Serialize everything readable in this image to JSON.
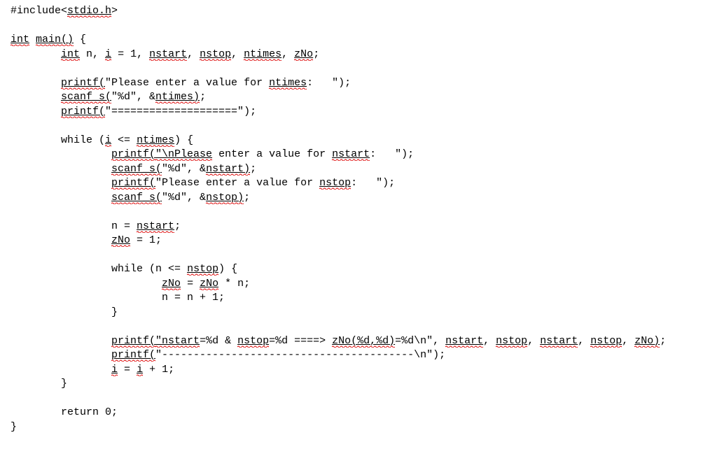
{
  "code": {
    "include": "#include<",
    "include_hdr": "stdio.h",
    "include_close": ">",
    "int_kw": "int",
    "main_decl": "main()",
    "main_open": " {",
    "decl_int": "int",
    "decl_n": " n, ",
    "decl_i": "i",
    "decl_eq1": " = 1, ",
    "decl_nstart": "nstart",
    "decl_c1": ", ",
    "decl_nstop": "nstop",
    "decl_c2": ", ",
    "decl_ntimes": "ntimes",
    "decl_c3": ", ",
    "decl_zno": "zNo",
    "decl_semi": ";",
    "p1_fn": "printf(",
    "p1_str": "\"Please enter a value for ",
    "p1_id": "ntimes",
    "p1_str2": ":   \");",
    "s1_fn": "scanf_s(",
    "s1_fmt": "\"%d\", &",
    "s1_id": "ntimes)",
    "s1_semi": ";",
    "p2_fn": "printf(",
    "p2_str": "\"====================\");",
    "w1_head1": "while (",
    "w1_i": "i",
    "w1_head2": " <= ",
    "w1_nt": "ntimes",
    "w1_head3": ") {",
    "p3_fn": "printf(",
    "p3_esc": "\"\\nPlease",
    "p3_mid": " enter a value for ",
    "p3_id": "nstart",
    "p3_end": ":   \");",
    "s2_fn": "scanf_s(",
    "s2_fmt": "\"%d\", &",
    "s2_id": "nstart)",
    "s2_semi": ";",
    "p4_fn": "printf(",
    "p4_str": "\"Please enter a value for ",
    "p4_id": "nstop",
    "p4_end": ":   \");",
    "s3_fn": "scanf_s(",
    "s3_fmt": "\"%d\", &",
    "s3_id": "nstop)",
    "s3_semi": ";",
    "asn_n1": "n = ",
    "asn_nstart": "nstart",
    "asn_semi1": ";",
    "asn_zno": "zNo",
    "asn_zno_v": " = 1;",
    "w2_head1": "while (n <= ",
    "w2_nstop": "nstop",
    "w2_head2": ") {",
    "mul_lhs": "zNo",
    "mul_eq": " = ",
    "mul_rhs": "zNo",
    "mul_tail": " * n;",
    "inc_n": "n = n + 1;",
    "w2_close": "}",
    "p5_fn": "printf(",
    "p5_a": "\"nstart",
    "p5_b": "=%d & ",
    "p5_c": "nstop",
    "p5_d": "=%d ====> ",
    "p5_e": "zNo(%d,%d)",
    "p5_f": "=%d\\n\", ",
    "p5_g": "nstart",
    "p5_h": ", ",
    "p5_i": "nstop",
    "p5_j": ", ",
    "p5_k": "nstart",
    "p5_l": ", ",
    "p5_m": "nstop",
    "p5_n": ", ",
    "p5_o": "zNo)",
    "p5_semi": ";",
    "p6_fn": "printf(",
    "p6_str": "\"----------------------------------------\\n\");",
    "inc_i1": "i",
    "inc_i2": " = ",
    "inc_i3": "i",
    "inc_i4": " + 1;",
    "w1_close": "}",
    "ret": "return 0;",
    "main_close": "}"
  }
}
